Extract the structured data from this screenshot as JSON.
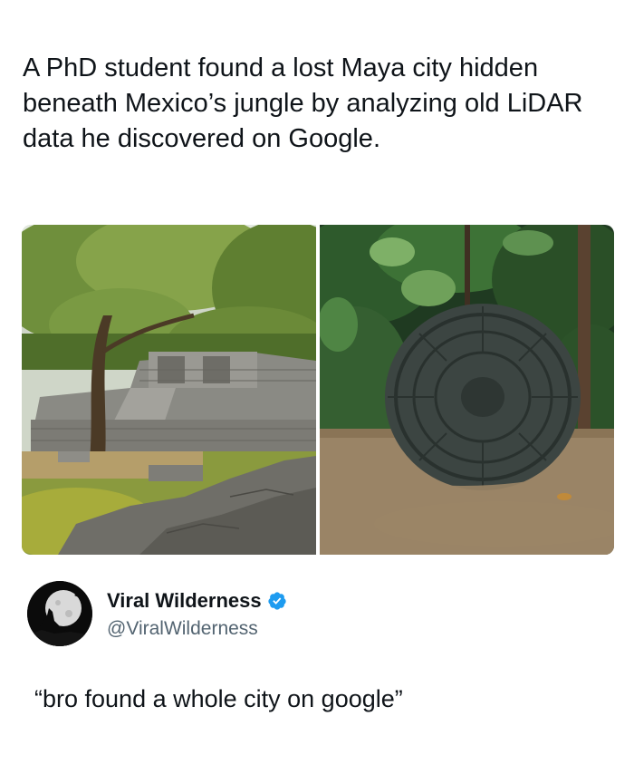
{
  "post": {
    "headline": "A PhD student found a lost Maya city hidden beneath Mexico’s jungle by analyzing old LiDAR data he discovered on Google.",
    "images": [
      {
        "icon": "maya-ruins-photo"
      },
      {
        "icon": "stone-calendar-photo"
      }
    ]
  },
  "author": {
    "name": "Viral Wilderness",
    "handle": "@ViralWilderness",
    "verified": true,
    "avatar_icon": "wolf-howling-moon-icon",
    "verified_color": "#1d9bf0"
  },
  "comment": "“bro found a whole city on google”"
}
